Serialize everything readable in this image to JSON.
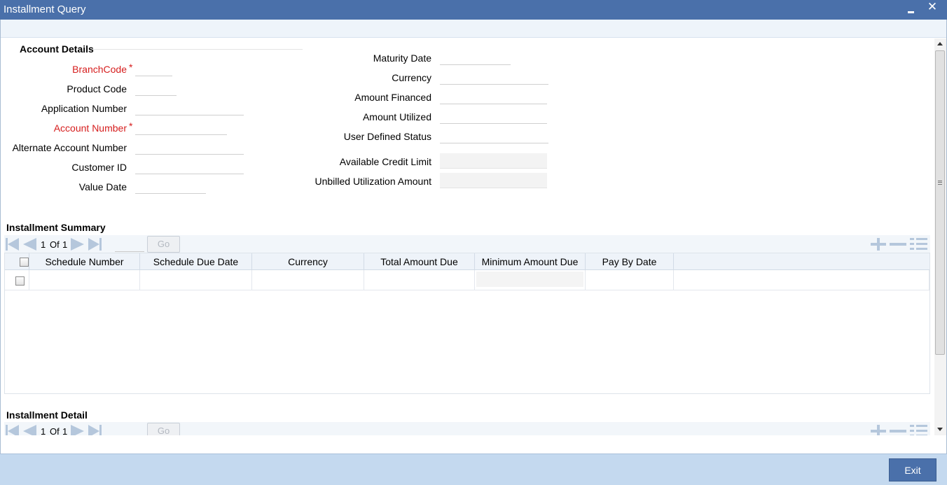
{
  "window": {
    "title": "Installment Query",
    "close_glyph": "✕"
  },
  "account_details": {
    "heading": "Account Details",
    "required_marker": "*",
    "left_fields": {
      "branch_code": {
        "label": "BranchCode",
        "value": ""
      },
      "product_code": {
        "label": "Product Code",
        "value": ""
      },
      "application_number": {
        "label": "Application Number",
        "value": ""
      },
      "account_number": {
        "label": "Account Number",
        "value": ""
      },
      "alternate_account_number": {
        "label": "Alternate Account Number",
        "value": ""
      },
      "customer_id": {
        "label": "Customer ID",
        "value": ""
      },
      "value_date": {
        "label": "Value Date",
        "value": ""
      }
    },
    "right_fields": {
      "maturity_date": {
        "label": "Maturity Date",
        "value": ""
      },
      "currency": {
        "label": "Currency",
        "value": ""
      },
      "amount_financed": {
        "label": "Amount Financed",
        "value": ""
      },
      "amount_utilized": {
        "label": "Amount Utilized",
        "value": ""
      },
      "user_defined_status": {
        "label": "User Defined Status",
        "value": ""
      },
      "available_credit_limit": {
        "label": "Available Credit Limit",
        "value": ""
      },
      "unbilled_utilization_amount": {
        "label": "Unbilled Utilization Amount",
        "value": ""
      }
    }
  },
  "installment_summary": {
    "heading": "Installment Summary",
    "pagination": {
      "current": "1",
      "of_label": "Of",
      "total": "1",
      "go_label": "Go",
      "page_input": ""
    },
    "columns": [
      "Schedule Number",
      "Schedule Due Date",
      "Currency",
      "Total Amount Due",
      "Minimum Amount Due",
      "Pay By Date"
    ],
    "rows": [
      [
        "",
        "",
        "",
        "",
        "",
        ""
      ]
    ]
  },
  "installment_detail": {
    "heading": "Installment Detail",
    "pagination": {
      "current": "1",
      "of_label": "Of",
      "total": "1",
      "go_label": "Go"
    }
  },
  "footer": {
    "exit_label": "Exit"
  },
  "colors": {
    "titlebar": "#4a70aa",
    "required_label": "#d61d1d",
    "footer": "#c4d9ef",
    "nav_icon": "#b5c7dc"
  },
  "icons": {
    "minimize": "minimize-icon",
    "close": "close-icon",
    "first": "first-page-icon",
    "prev": "previous-page-icon",
    "next": "next-page-icon",
    "last": "last-page-icon",
    "add_row": "add-row-icon",
    "delete_row": "delete-row-icon",
    "view_list": "list-view-icon"
  }
}
